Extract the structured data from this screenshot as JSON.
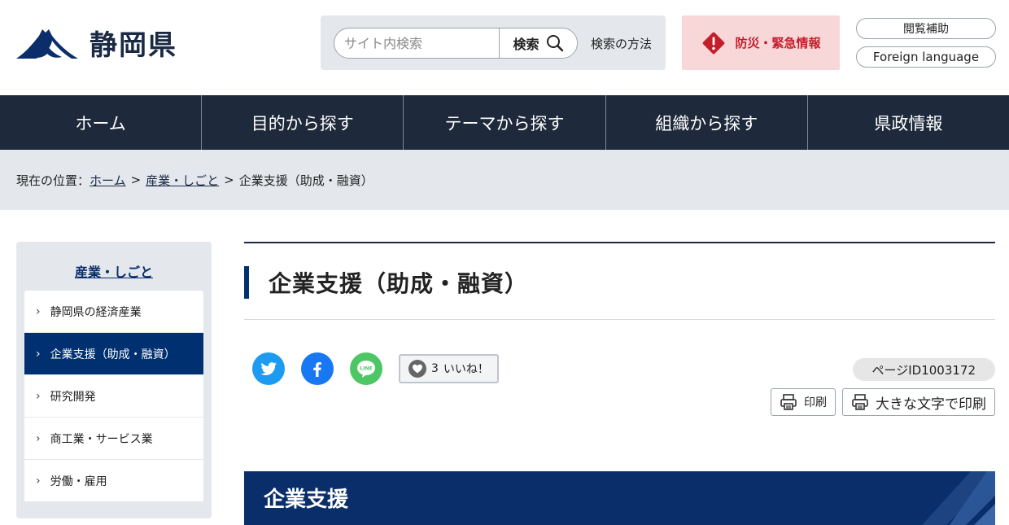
{
  "header": {
    "logo_text": "静岡県",
    "search": {
      "placeholder": "サイト内検索",
      "button_label": "検索",
      "method_link": "検索の方法"
    },
    "disaster_label": "防災・緊急情報",
    "accessibility_label": "閲覧補助",
    "language_label": "Foreign language"
  },
  "nav": {
    "items": [
      "ホーム",
      "目的から探す",
      "テーマから探す",
      "組織から探す",
      "県政情報"
    ]
  },
  "breadcrumb": {
    "prefix": "現在の位置：",
    "items": [
      "ホーム",
      "産業・しごと"
    ],
    "current": "企業支援（助成・融資）",
    "separator": ">"
  },
  "sidebar": {
    "title": "産業・しごと",
    "items": [
      {
        "label": "静岡県の経済産業",
        "active": false
      },
      {
        "label": "企業支援（助成・融資）",
        "active": true
      },
      {
        "label": "研究開発",
        "active": false
      },
      {
        "label": "商工業・サービス業",
        "active": false
      },
      {
        "label": "労働・雇用",
        "active": false
      }
    ]
  },
  "main": {
    "title": "企業支援（助成・融資）",
    "like": {
      "count": "3",
      "label": "いいね！"
    },
    "page_id": "ページID1003172",
    "print_label": "印刷",
    "print_large_label": "大きな文字で印刷",
    "section_heading": "企業支援"
  },
  "colors": {
    "navy": "#1e2a3b",
    "accent_blue": "#003070",
    "section_blue": "#0a2e6a",
    "disaster_bg": "#f8d7d9",
    "disaster_red": "#c41e2a",
    "panel_gray": "#e4e8ed"
  }
}
